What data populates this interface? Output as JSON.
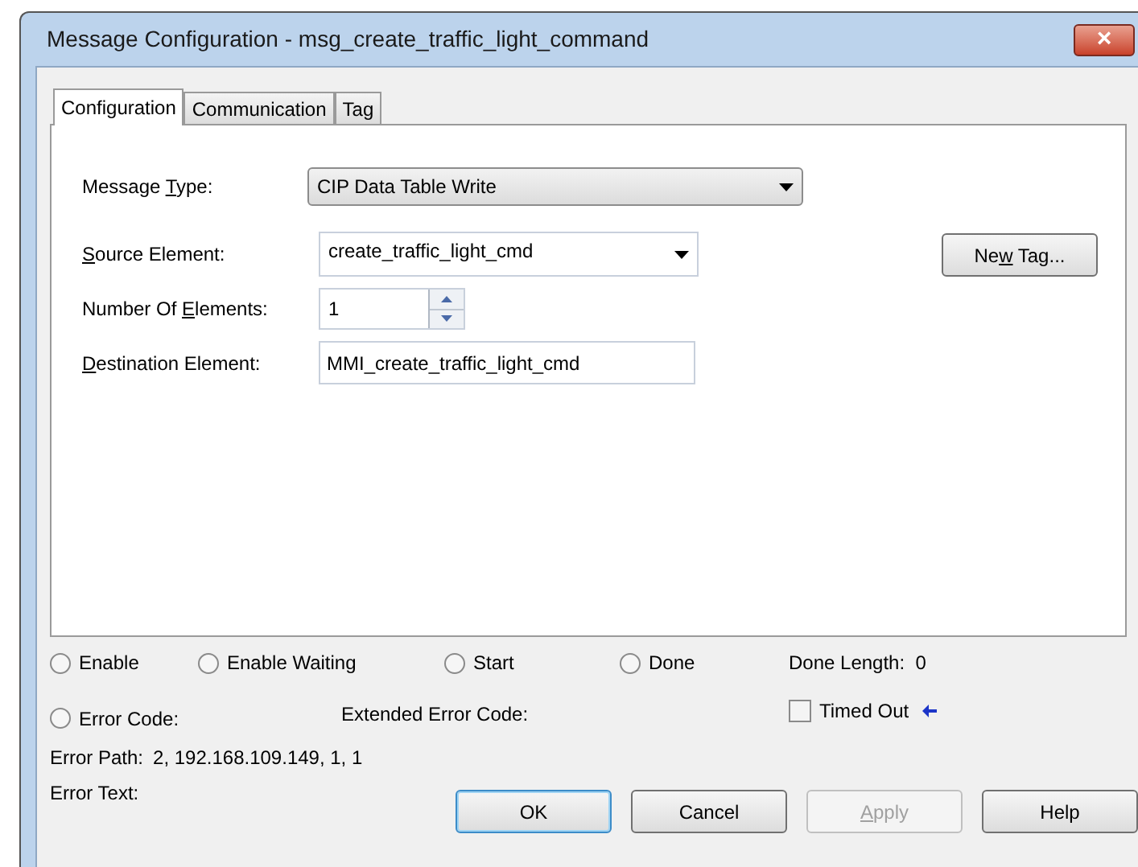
{
  "window": {
    "title": "Message Configuration - msg_create_traffic_light_command",
    "close": "×"
  },
  "tabs": [
    {
      "label": "Configuration",
      "selected": true
    },
    {
      "label": "Communication",
      "selected": false
    },
    {
      "label": "Tag",
      "selected": false
    }
  ],
  "fields": [
    {
      "kind": "dropdown",
      "label_parts": [
        {
          "text": "Message ",
          "underline": false
        },
        {
          "text": "T",
          "underline": true
        },
        {
          "text": "ype:",
          "underline": false
        }
      ],
      "value": "CIP Data Table Write"
    },
    {
      "kind": "combo",
      "label_parts": [
        {
          "text": "S",
          "underline": true
        },
        {
          "text": "ource Element:",
          "underline": false
        }
      ],
      "value": "create_traffic_light_cmd"
    },
    {
      "kind": "spin",
      "label_parts": [
        {
          "text": "Number Of ",
          "underline": false
        },
        {
          "text": "E",
          "underline": true
        },
        {
          "text": "lements:",
          "underline": false
        }
      ],
      "value": "1"
    },
    {
      "kind": "text",
      "label_parts": [
        {
          "text": "D",
          "underline": true
        },
        {
          "text": "estination Element:",
          "underline": false
        }
      ],
      "value": "MMI_create_traffic_light_cmd"
    }
  ],
  "new_tag_button": {
    "label_parts": [
      {
        "text": "Ne",
        "underline": false
      },
      {
        "text": "w",
        "underline": true
      },
      {
        "text": " Tag...",
        "underline": false
      }
    ]
  },
  "status_indicators": [
    {
      "label": "Enable",
      "on": false
    },
    {
      "label": "Enable Waiting",
      "on": false
    },
    {
      "label": "Start",
      "on": false
    },
    {
      "label": "Done",
      "on": false
    }
  ],
  "done_length": {
    "label": "Done Length:",
    "value": "0"
  },
  "error_code": {
    "label": "Error Code:",
    "on": false
  },
  "extended_error_code": {
    "label": "Extended Error Code:"
  },
  "timed_out": {
    "label": "Timed Out",
    "checked": false
  },
  "error_path": {
    "label": "Error Path:",
    "value": "2, 192.168.109.149, 1, 1"
  },
  "error_text": {
    "label": "Error Text:"
  },
  "buttons": [
    {
      "label_parts": [
        {
          "text": "OK",
          "underline": false
        }
      ],
      "default": true,
      "disabled": false
    },
    {
      "label_parts": [
        {
          "text": "Cancel",
          "underline": false
        }
      ],
      "default": false,
      "disabled": false
    },
    {
      "label_parts": [
        {
          "text": "A",
          "underline": true
        },
        {
          "text": "pply",
          "underline": false
        }
      ],
      "default": false,
      "disabled": true
    },
    {
      "label_parts": [
        {
          "text": "Help",
          "underline": false
        }
      ],
      "default": false,
      "disabled": false
    }
  ]
}
